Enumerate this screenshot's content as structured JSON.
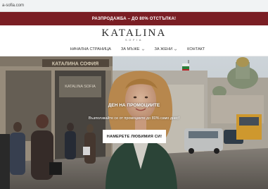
{
  "browser": {
    "address": "a-sofia.com"
  },
  "promo": {
    "text": "РАЗПРОДАЖБА – ДО 80% ОТСТЪПКА!"
  },
  "header": {
    "logo": "KATALINA",
    "logo_sub": "SOFIA",
    "nav": [
      {
        "label": "НАЧАЛНА СТРАНИЦА",
        "has_dropdown": false
      },
      {
        "label": "ЗА МЪЖЕ",
        "has_dropdown": true
      },
      {
        "label": "ЗА ЖЕНИ",
        "has_dropdown": true
      },
      {
        "label": "КОНТАКТ",
        "has_dropdown": false
      }
    ]
  },
  "hero": {
    "store_sign_top": "КАТАЛИНА СОФИЯ",
    "store_sign_window": "KATALINA SOFIA",
    "title": "ДЕН НА ПРОМОЦИИТЕ",
    "subtitle": "Възползвайте се от промоциите до 80% само днес!",
    "cta_label": "НАМЕРЕТЕ ЛЮБИМИЯ СИ!"
  },
  "colors": {
    "promo_bg": "#7a1e24",
    "cta_bg": "#ffffff"
  }
}
